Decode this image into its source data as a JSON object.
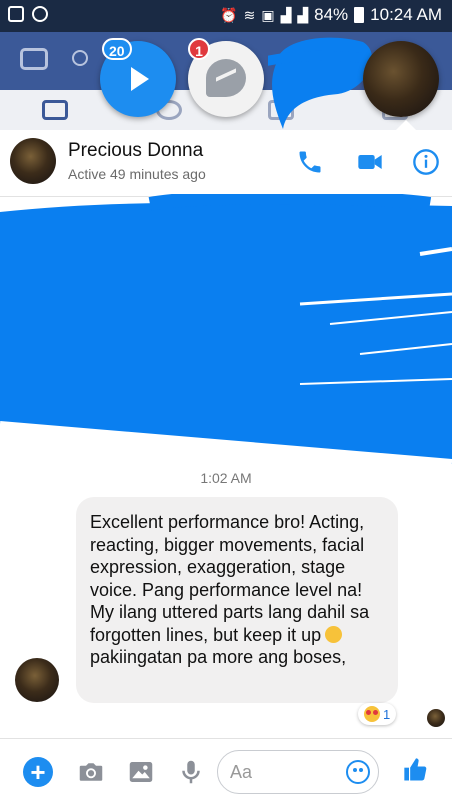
{
  "status_bar": {
    "battery": "84%",
    "time": "10:24 AM"
  },
  "chat_heads": {
    "play_badge": "20",
    "messenger_badge": "1"
  },
  "contact": {
    "name": "Precious Donna",
    "status": "Active 49 minutes ago"
  },
  "conversation": {
    "timestamp": "1:02 AM",
    "message_text": "Excellent performance bro! Acting, reacting, bigger movements, facial expression, exaggeration, stage voice. Pang performance level na! My ilang uttered parts lang dahil sa forgotten lines, but keep it up",
    "message_text_end": "pakiingatan pa more ang boses,",
    "reaction_count": "1"
  },
  "composer": {
    "placeholder": "Aa"
  },
  "colors": {
    "messenger_blue": "#1d8df0",
    "scribble_blue": "#0a7ff0",
    "facebook_blue": "#3b5998",
    "badge_red": "#e0393e"
  }
}
